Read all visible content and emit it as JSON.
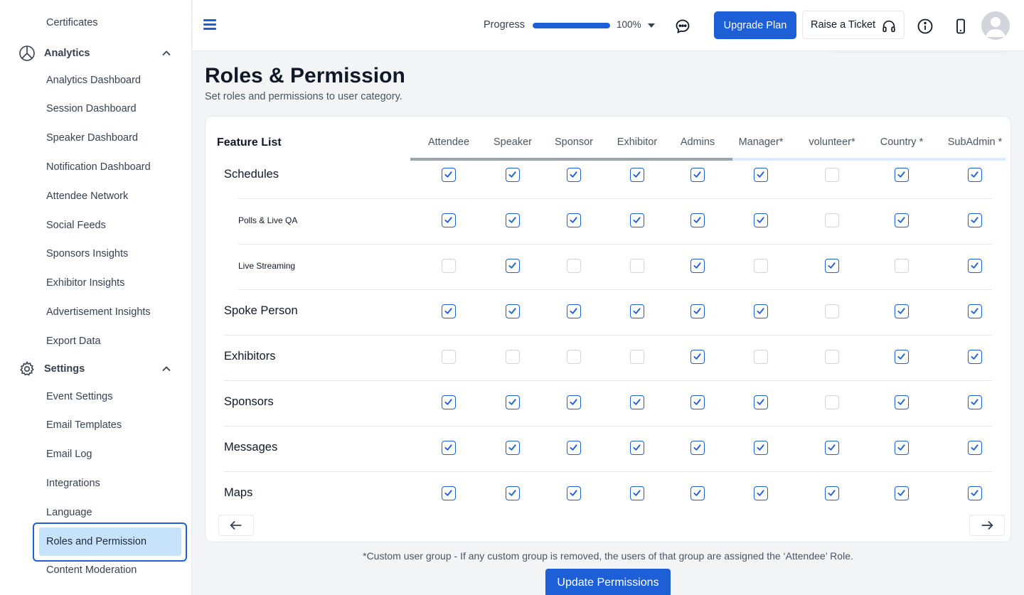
{
  "sidebar": {
    "items_top": [
      "Certificates"
    ],
    "analytics": {
      "label": "Analytics",
      "items": [
        "Analytics Dashboard",
        "Session Dashboard",
        "Speaker Dashboard",
        "Notification Dashboard",
        "Attendee Network",
        "Social Feeds",
        "Sponsors Insights",
        "Exhibitor Insights",
        "Advertisement Insights",
        "Export Data"
      ]
    },
    "settings": {
      "label": "Settings",
      "items": [
        "Event Settings",
        "Email Templates",
        "Email Log",
        "Integrations",
        "Language",
        "Roles and Permission",
        "Content Moderation"
      ],
      "active": "Roles and Permission"
    }
  },
  "topbar": {
    "progress_label": "Progress",
    "progress_value": 100,
    "progress_text": "100%",
    "upgrade_label": "Upgrade Plan",
    "ticket_label": "Raise a Ticket"
  },
  "page": {
    "title": "Roles & Permission",
    "subtitle": "Set roles and permissions to user category."
  },
  "table": {
    "feature_header": "Feature List",
    "columns": [
      "Attendee",
      "Speaker",
      "Sponsor",
      "Exhibitor",
      "Admins",
      "Manager*",
      "volunteer*",
      "Country *",
      "SubAdmin *"
    ],
    "rows": [
      {
        "label": "Schedules",
        "sub": false,
        "checks": [
          true,
          true,
          true,
          true,
          true,
          true,
          false,
          true,
          true
        ]
      },
      {
        "label": "Polls & Live QA",
        "sub": true,
        "checks": [
          true,
          true,
          true,
          true,
          true,
          true,
          false,
          true,
          true
        ]
      },
      {
        "label": "Live Streaming",
        "sub": true,
        "checks": [
          false,
          true,
          false,
          false,
          true,
          false,
          true,
          false,
          true
        ]
      },
      {
        "label": "Spoke Person",
        "sub": false,
        "checks": [
          true,
          true,
          true,
          true,
          true,
          true,
          false,
          true,
          true
        ]
      },
      {
        "label": "Exhibitors",
        "sub": false,
        "checks": [
          false,
          false,
          false,
          false,
          true,
          false,
          false,
          true,
          true
        ]
      },
      {
        "label": "Sponsors",
        "sub": false,
        "checks": [
          true,
          true,
          true,
          true,
          true,
          true,
          false,
          true,
          true
        ]
      },
      {
        "label": "Messages",
        "sub": false,
        "checks": [
          true,
          true,
          true,
          true,
          true,
          true,
          true,
          true,
          true
        ]
      },
      {
        "label": "Maps",
        "sub": false,
        "checks": [
          true,
          true,
          true,
          true,
          true,
          true,
          true,
          true,
          true
        ]
      }
    ]
  },
  "footnote": "*Custom user group - If any custom group is removed, the users of that group are assigned the ‘Attendee’ Role.",
  "update_label": "Update Permissions",
  "colors": {
    "accent": "#1d5fd6",
    "active_bg": "#c7e3fb"
  }
}
